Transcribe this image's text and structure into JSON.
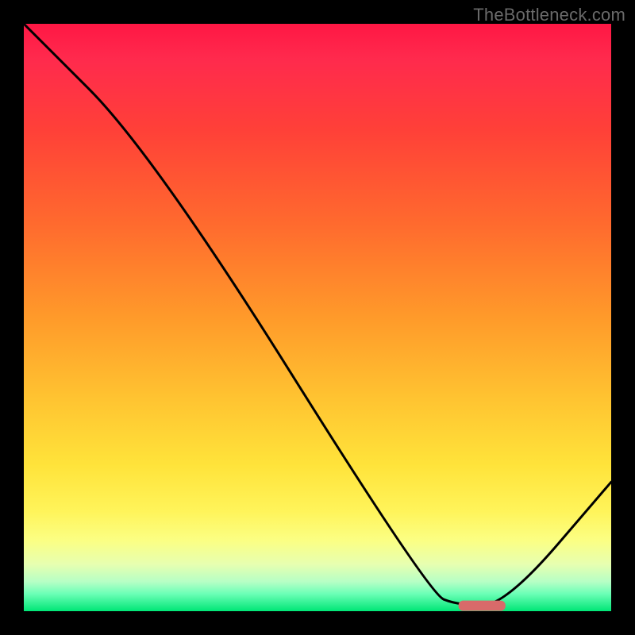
{
  "watermark": "TheBottleneck.com",
  "chart_data": {
    "type": "line",
    "title": "",
    "xlabel": "",
    "ylabel": "",
    "xlim": [
      0,
      100
    ],
    "ylim": [
      0,
      100
    ],
    "grid": false,
    "series": [
      {
        "name": "curve",
        "x": [
          0,
          22,
          69,
          74,
          82,
          100
        ],
        "y": [
          100,
          78,
          3,
          1,
          1,
          22
        ]
      }
    ],
    "marker": {
      "x_start": 74,
      "x_end": 82,
      "y": 1,
      "color": "#d86a6a"
    },
    "gradient_stops": [
      {
        "pos": 0.0,
        "color": "#ff1744"
      },
      {
        "pos": 0.5,
        "color": "#ff9a2a"
      },
      {
        "pos": 0.75,
        "color": "#ffe33a"
      },
      {
        "pos": 0.92,
        "color": "#e7ffb0"
      },
      {
        "pos": 1.0,
        "color": "#00e676"
      }
    ]
  }
}
